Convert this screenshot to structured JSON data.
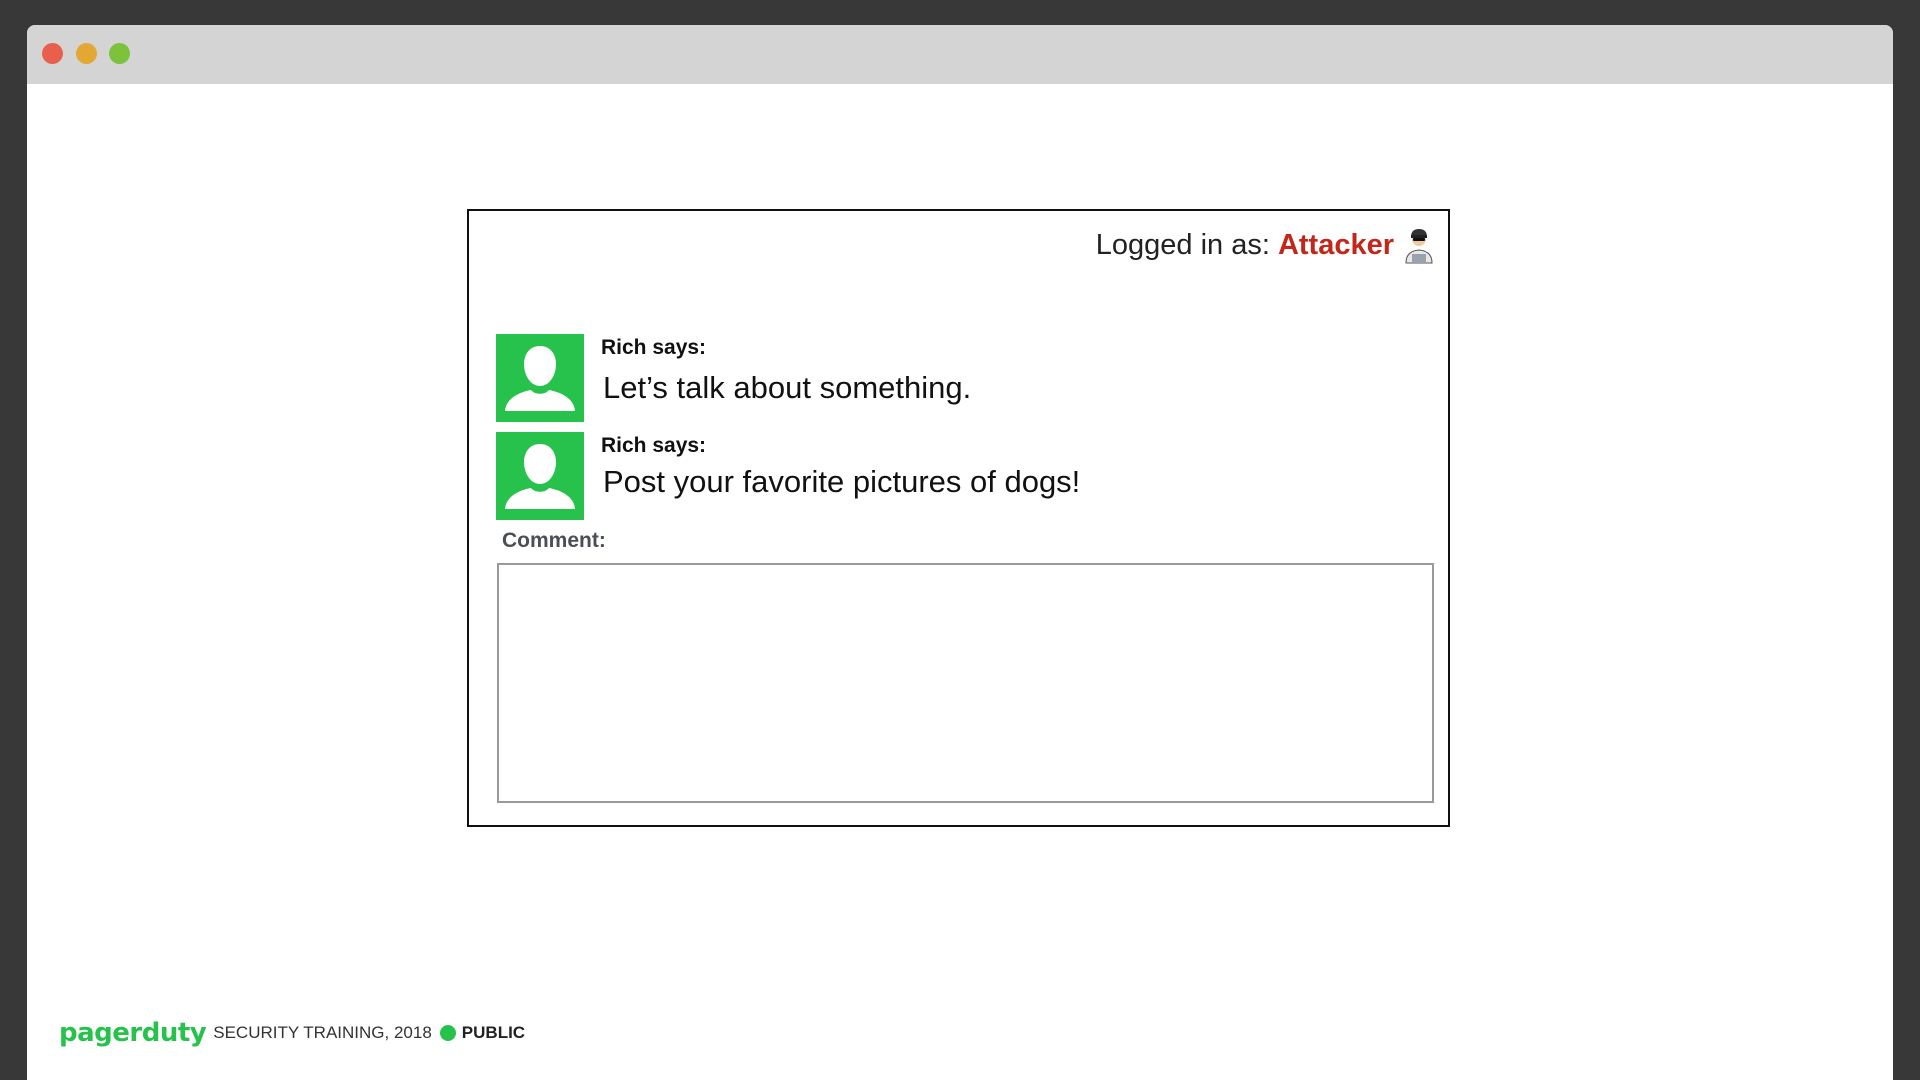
{
  "colors": {
    "desktop_bg": "#383838",
    "titlebar_bg": "#d4d4d4",
    "close": "#e8604c",
    "minimize": "#e3a834",
    "zoom": "#7cc23a",
    "avatar_bg": "#27c24c",
    "attacker_red": "#c1271a",
    "brand_green": "#27c24c"
  },
  "window": {
    "controls": [
      "close",
      "minimize",
      "zoom"
    ]
  },
  "session": {
    "label": "Logged in as:",
    "username": "Attacker",
    "icon": "hacker-icon"
  },
  "posts": [
    {
      "author": "Rich says:",
      "message": "Let’s talk about something.",
      "avatar_icon": "user-silhouette-icon"
    },
    {
      "author": "Rich says:",
      "message": "Post your favorite pictures of dogs!",
      "avatar_icon": "user-silhouette-icon"
    }
  ],
  "comment_form": {
    "label": "Comment:",
    "value": "",
    "placeholder": ""
  },
  "footer": {
    "brand": "pagerduty",
    "training": "SECURITY TRAINING, 2018",
    "visibility": "PUBLIC"
  }
}
